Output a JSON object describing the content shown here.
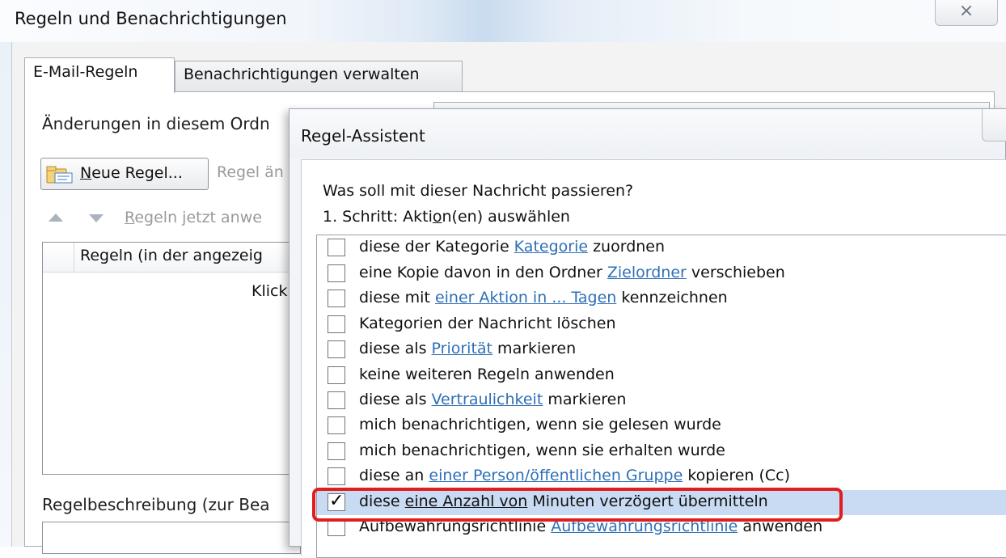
{
  "main_window": {
    "title": "Regeln und Benachrichtigungen",
    "close_glyph": "⨯",
    "tabs": [
      {
        "label": "E-Mail-Regeln",
        "active": true
      },
      {
        "label": "Benachrichtigungen verwalten",
        "active": false
      }
    ],
    "changes_label": "Änderungen in diesem Ordn",
    "toolbar": {
      "new_rule_mnemonic": "N",
      "new_rule_rest": "eue Regel...",
      "change_rule_pre": "Re",
      "change_rule_mnemonic": "g",
      "change_rule_post": "el än"
    },
    "apply_now_mnemonic": "R",
    "apply_now_rest": "egeln jetzt anwe",
    "rules_list": {
      "header": "Regeln (in der angezeig",
      "click_hint": "Klick"
    },
    "rule_description_label": "Regelbeschreibung (zur Bea"
  },
  "wizard": {
    "title": "Regel-Assistent",
    "question": "Was soll mit dieser Nachricht passieren?",
    "step_pre": "1. Schritt: Akti",
    "step_mnemonic": "o",
    "step_post": "n(en) auswählen",
    "actions": [
      {
        "pre": "diese der Kategorie ",
        "link": "Kategorie",
        "post": " zuordnen",
        "checked": false
      },
      {
        "pre": "eine Kopie davon in den Ordner ",
        "link": "Zielordner",
        "post": " verschieben",
        "checked": false
      },
      {
        "pre": "diese mit ",
        "link": "einer Aktion in ... Tagen",
        "post": " kennzeichnen",
        "checked": false
      },
      {
        "pre": "Kategorien der Nachricht löschen",
        "link": "",
        "post": "",
        "checked": false
      },
      {
        "pre": "diese als ",
        "link": "Priorität",
        "post": " markieren",
        "checked": false
      },
      {
        "pre": "keine weiteren Regeln anwenden",
        "link": "",
        "post": "",
        "checked": false
      },
      {
        "pre": "diese als ",
        "link": "Vertraulichkeit",
        "post": " markieren",
        "checked": false
      },
      {
        "pre": "mich benachrichtigen, wenn sie gelesen wurde",
        "link": "",
        "post": "",
        "checked": false
      },
      {
        "pre": "mich benachrichtigen, wenn sie erhalten wurde",
        "link": "",
        "post": "",
        "checked": false
      },
      {
        "pre": "diese an ",
        "link": "einer Person/öffentlichen Gruppe",
        "post": " kopieren (Cc)",
        "checked": false
      },
      {
        "pre": "diese ",
        "link": "eine Anzahl von",
        "post": " Minuten verzögert übermitteln",
        "checked": true,
        "selected": true
      },
      {
        "pre": "Aufbewahrungsrichtlinie ",
        "link": "Aufbewahrungsrichtlinie",
        "post": " anwenden",
        "checked": false
      }
    ],
    "check_mark": "✓"
  },
  "colors": {
    "highlight_border": "#e01e1e",
    "selection": "#c8dbf2",
    "link": "#2e6fb7"
  }
}
